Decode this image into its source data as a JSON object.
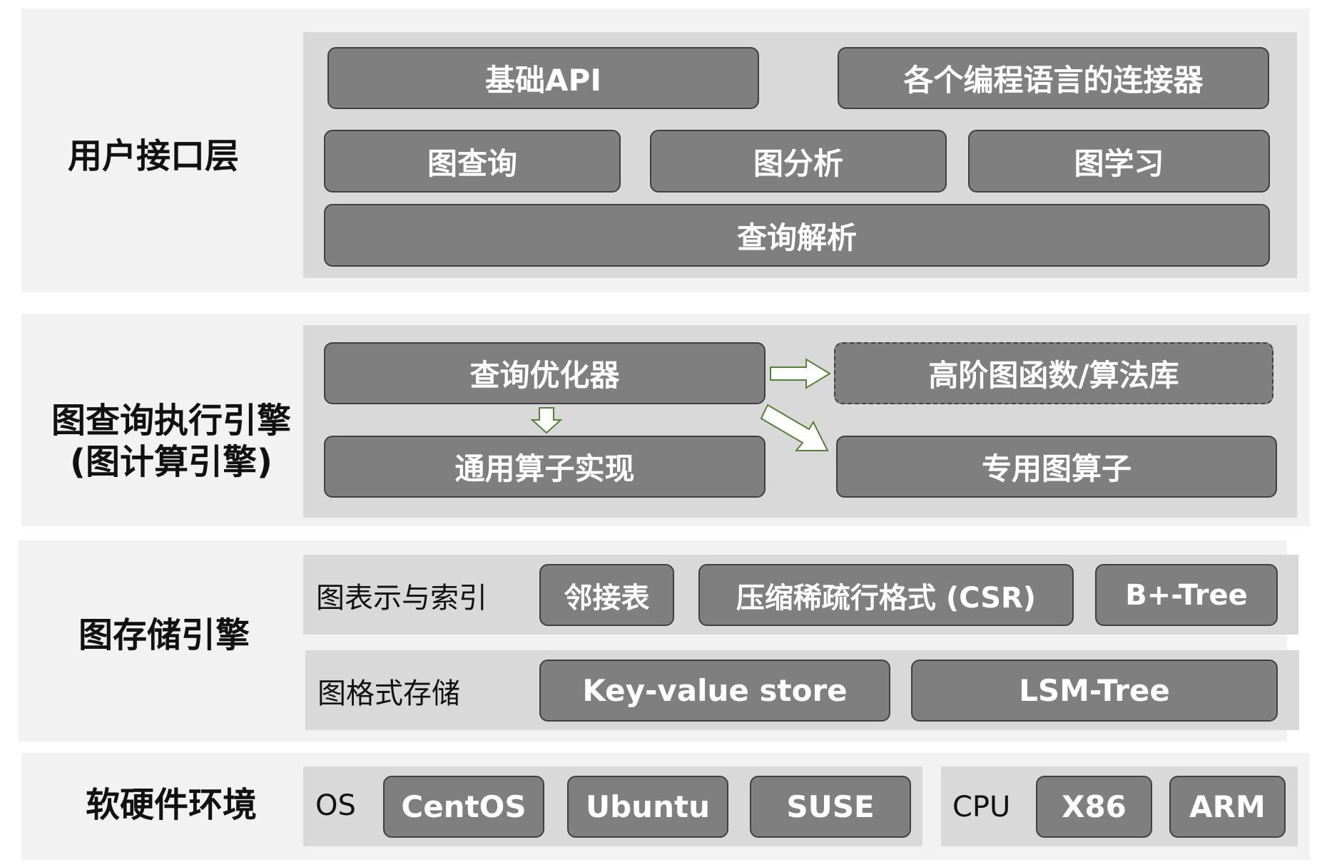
{
  "layers": {
    "user_interface": {
      "title": "用户接口层",
      "basic_api": "基础API",
      "connectors": "各个编程语言的连接器",
      "graph_query": "图查询",
      "graph_analysis": "图分析",
      "graph_learning": "图学习",
      "query_parsing": "查询解析"
    },
    "query_engine": {
      "title_line1": "图查询执行引擎",
      "title_line2": "(图计算引擎)",
      "query_optimizer": "查询优化器",
      "higher_order_lib": "高阶图函数/算法库",
      "generic_operators": "通用算子实现",
      "dedicated_operators": "专用图算子"
    },
    "storage_engine": {
      "title": "图存储引擎",
      "representation_label": "图表示与索引",
      "adjacency_list": "邻接表",
      "csr": "压缩稀疏行格式 (CSR)",
      "bplus_tree": "B+-Tree",
      "format_label": "图格式存储",
      "kv_store": "Key-value store",
      "lsm_tree": "LSM-Tree"
    },
    "environment": {
      "title": "软硬件环境",
      "os_label": "OS",
      "centos": "CentOS",
      "ubuntu": "Ubuntu",
      "suse": "SUSE",
      "cpu_label": "CPU",
      "x86": "X86",
      "arm": "ARM"
    }
  },
  "colors": {
    "layer_bg": "#f2f2f2",
    "panel_bg": "#d9d9d9",
    "box_fill": "#7f7f7f",
    "box_border": "#404040",
    "box_text": "#ffffff",
    "arrow_stroke": "#548235"
  }
}
